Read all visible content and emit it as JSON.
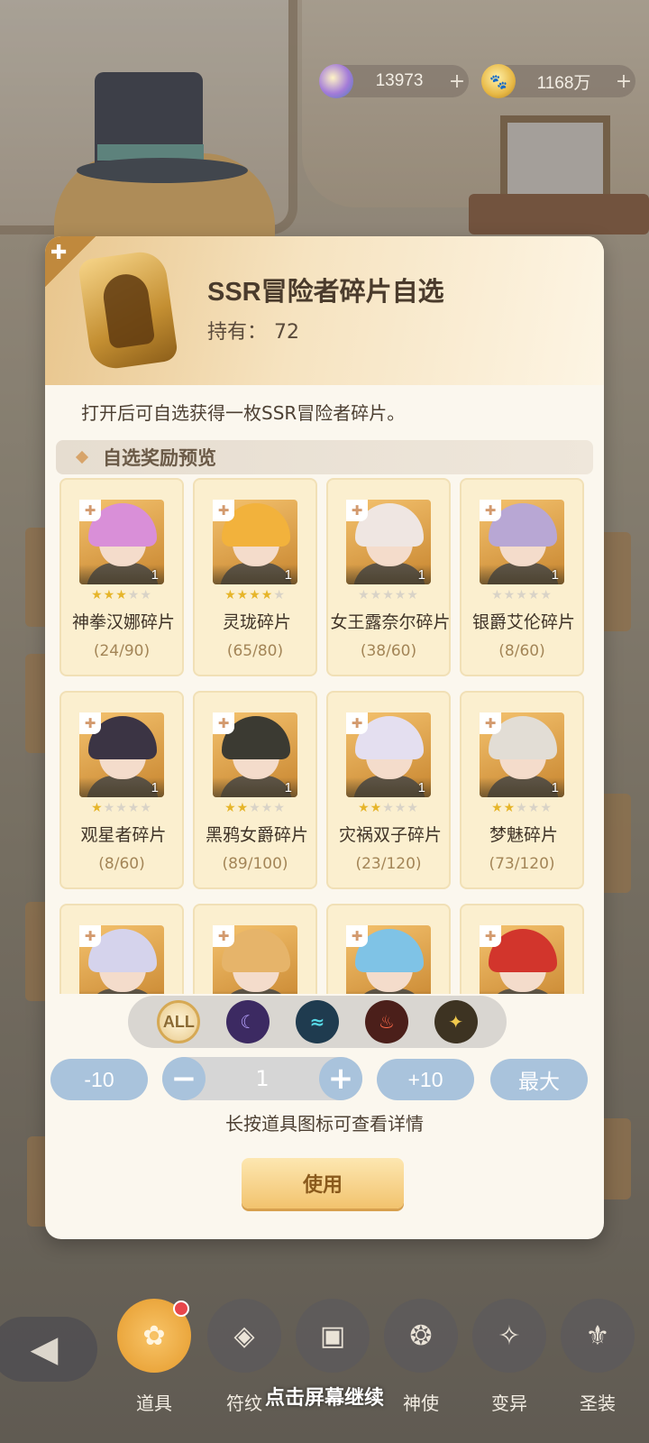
{
  "currency": [
    {
      "icon": "gem-icon",
      "value": "13973",
      "plus": "+"
    },
    {
      "icon": "paw-coin-icon",
      "value": "1168万",
      "plus": "+"
    }
  ],
  "item": {
    "title": "SSR冒险者碎片自选",
    "owned_label": "持有：",
    "owned_value": "72",
    "description": "打开后可自选获得一枚SSR冒险者碎片。"
  },
  "section_title": "自选奖励预览",
  "cards": [
    {
      "name": "神拳汉娜碎片",
      "progress": "(24/90)",
      "count": "1",
      "stars": 3,
      "hair": "#d98fd8"
    },
    {
      "name": "灵珑碎片",
      "progress": "(65/80)",
      "count": "1",
      "stars": 4,
      "hair": "#f2b23c"
    },
    {
      "name": "女王露奈尔碎片",
      "progress": "(38/60)",
      "count": "1",
      "stars": 0,
      "hair": "#efe6e2"
    },
    {
      "name": "银爵艾伦碎片",
      "progress": "(8/60)",
      "count": "1",
      "stars": 0,
      "hair": "#b8a7d4"
    },
    {
      "name": "观星者碎片",
      "progress": "(8/60)",
      "count": "1",
      "stars": 1,
      "hair": "#3b3444"
    },
    {
      "name": "黑鸦女爵碎片",
      "progress": "(89/100)",
      "count": "1",
      "stars": 2,
      "hair": "#3b3a32"
    },
    {
      "name": "灾祸双子碎片",
      "progress": "(23/120)",
      "count": "1",
      "stars": 2,
      "hair": "#e4dff0"
    },
    {
      "name": "梦魅碎片",
      "progress": "(73/120)",
      "count": "1",
      "stars": 2,
      "hair": "#e2ddd5"
    },
    {
      "name": "",
      "progress": "",
      "count": "",
      "stars": 0,
      "hair": "#d5d3ec"
    },
    {
      "name": "",
      "progress": "",
      "count": "",
      "stars": 0,
      "hair": "#e6b46a"
    },
    {
      "name": "",
      "progress": "",
      "count": "",
      "stars": 0,
      "hair": "#7fc3e6"
    },
    {
      "name": "",
      "progress": "",
      "count": "",
      "stars": 0,
      "hair": "#d2352c"
    }
  ],
  "filters": [
    {
      "name": "filter-all-button",
      "label": "ALL",
      "cls": "all"
    },
    {
      "name": "filter-moon-button",
      "label": "☾",
      "cls": "moon"
    },
    {
      "name": "filter-wind-button",
      "label": "≈",
      "cls": "wind"
    },
    {
      "name": "filter-fire-button",
      "label": "♨",
      "cls": "fire"
    },
    {
      "name": "filter-light-button",
      "label": "✦",
      "cls": "light"
    }
  ],
  "quantity": {
    "minus10": "-10",
    "minus": "−",
    "value": "1",
    "plus": "+",
    "plus10": "+10",
    "max": "最大"
  },
  "hint": "长按道具图标可查看详情",
  "use_button": "使用",
  "bottom_nav": {
    "back": "◀",
    "items": [
      {
        "label": "道具",
        "icon": "bag-icon",
        "glyph": "✿",
        "active": true
      },
      {
        "label": "符纹",
        "icon": "rune-icon",
        "glyph": "◈",
        "active": false
      },
      {
        "label": "",
        "icon": "card-icon",
        "glyph": "▣",
        "active": false
      },
      {
        "label": "神使",
        "icon": "envoy-icon",
        "glyph": "❂",
        "active": false
      },
      {
        "label": "变异",
        "icon": "mutation-icon",
        "glyph": "✧",
        "active": false
      },
      {
        "label": "圣装",
        "icon": "holy-gear-icon",
        "glyph": "⚜",
        "active": false
      }
    ],
    "continue_text": "点击屏幕继续"
  }
}
